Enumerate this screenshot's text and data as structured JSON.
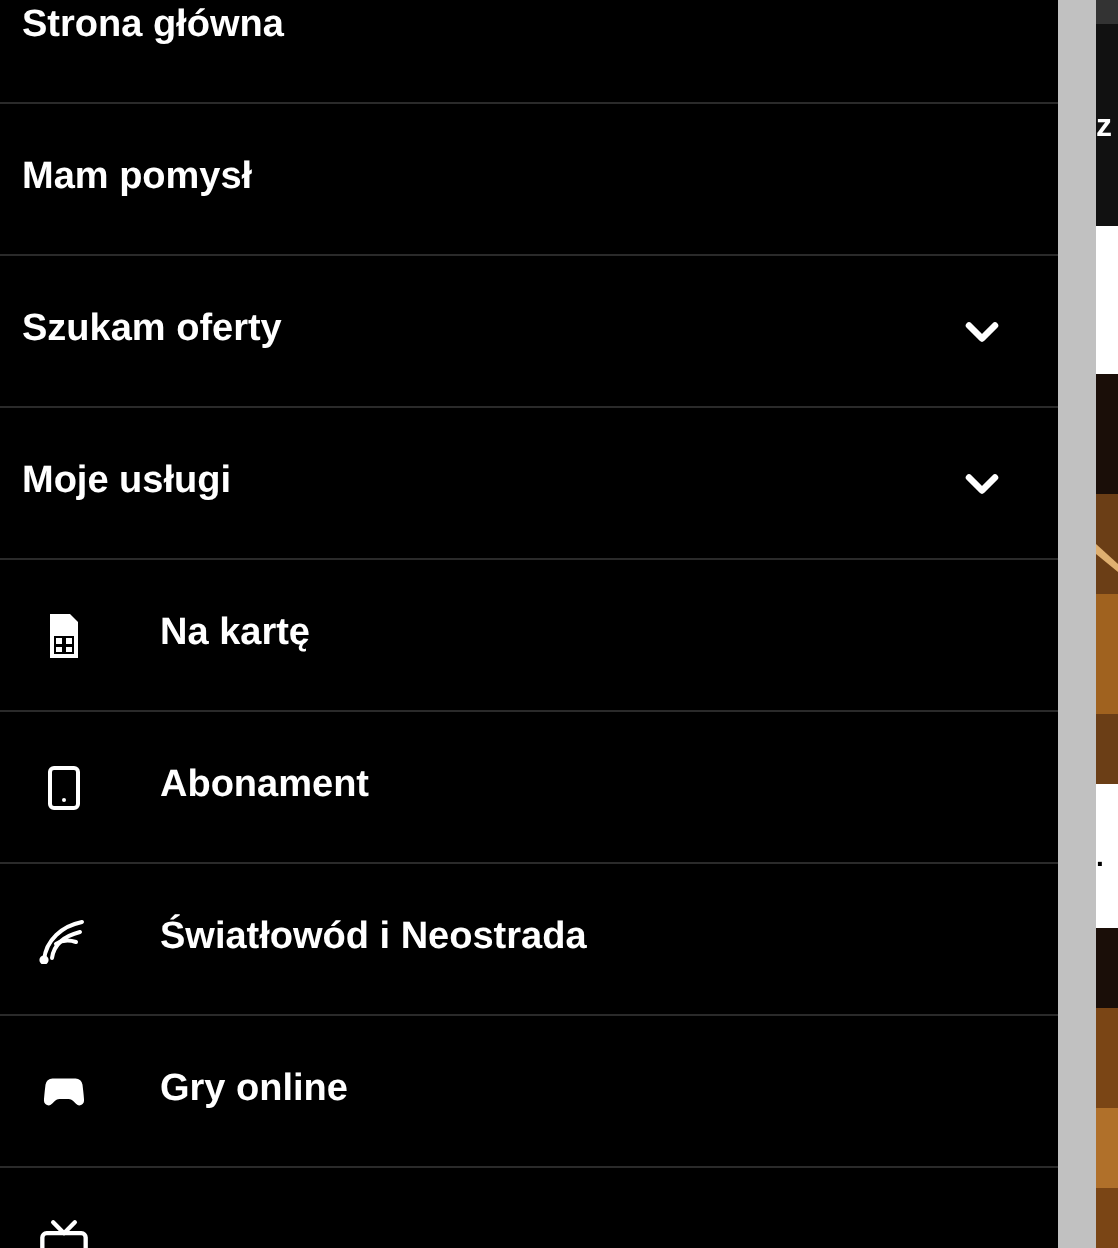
{
  "menu": [
    {
      "label": "Strona główna",
      "expandable": false
    },
    {
      "label": "Mam pomysł",
      "expandable": false
    },
    {
      "label": "Szukam oferty",
      "expandable": true
    },
    {
      "label": "Moje usługi",
      "expandable": true,
      "children": [
        {
          "label": "Na kartę",
          "kind": "sim"
        },
        {
          "label": "Abonament",
          "kind": "phone"
        },
        {
          "label": "Światłowód i Neostrada",
          "kind": "fiber"
        },
        {
          "label": "Gry online",
          "kind": "gamepad"
        },
        {
          "kind": "tv"
        }
      ]
    }
  ],
  "page_behind": {
    "texts": [
      "z",
      "."
    ]
  }
}
